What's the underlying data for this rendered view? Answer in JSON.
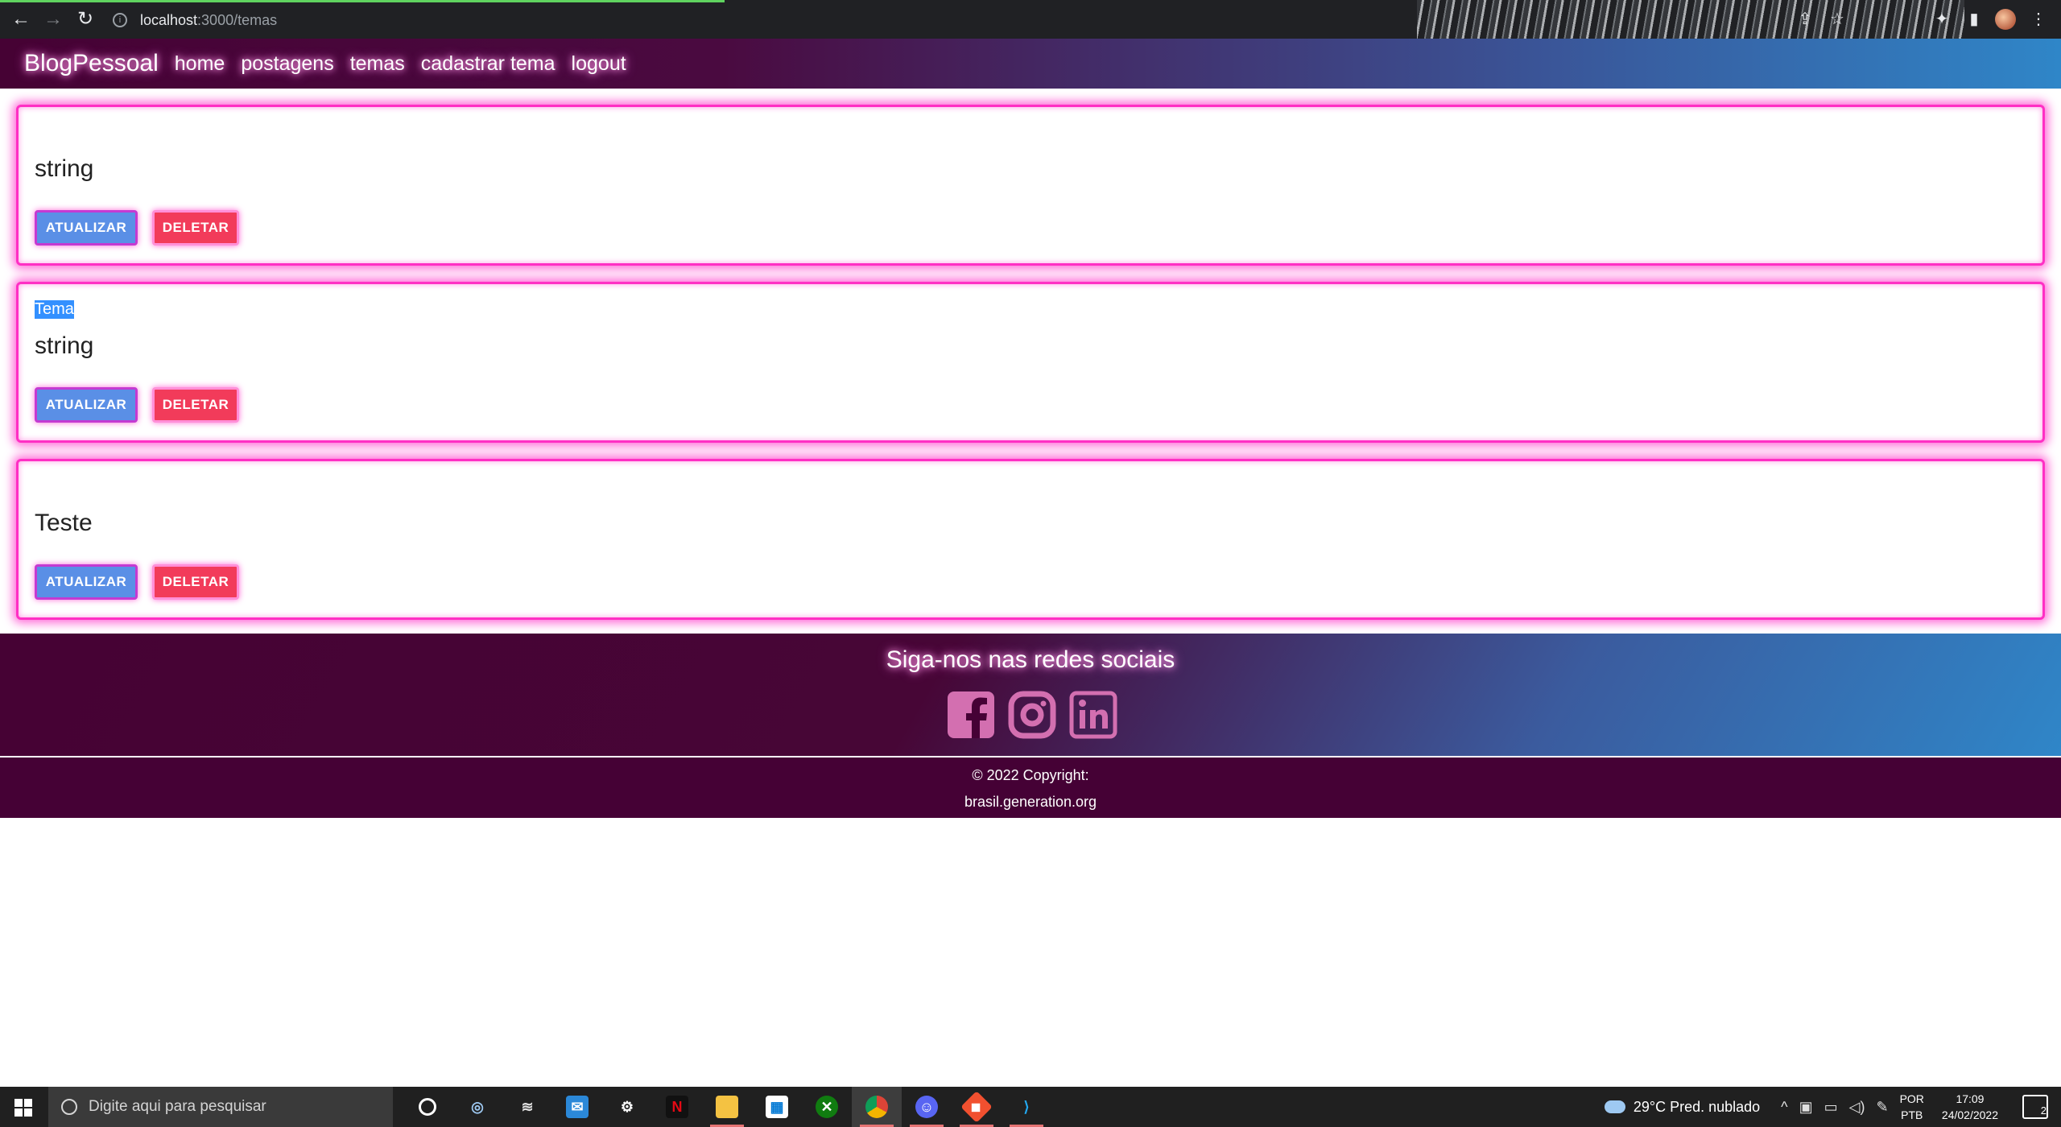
{
  "browser": {
    "url_host": "localhost",
    "url_path": ":3000/temas"
  },
  "navbar": {
    "brand": "BlogPessoal",
    "links": [
      "home",
      "postagens",
      "temas",
      "cadastrar tema",
      "logout"
    ]
  },
  "cards": [
    {
      "label": "",
      "title": "string",
      "update_label": "ATUALIZAR",
      "delete_label": "DELETAR"
    },
    {
      "label": "Tema",
      "title": "string",
      "update_label": "ATUALIZAR",
      "delete_label": "DELETAR"
    },
    {
      "label": "",
      "title": "Teste",
      "update_label": "ATUALIZAR",
      "delete_label": "DELETAR"
    }
  ],
  "footer": {
    "heading": "Siga-nos nas redes sociais",
    "social": [
      "facebook-icon",
      "instagram-icon",
      "linkedin-icon"
    ],
    "copyright": "© 2022 Copyright:",
    "site": "brasil.generation.org"
  },
  "taskbar": {
    "search_placeholder": "Digite aqui para pesquisar",
    "weather": "29°C  Pred. nublado",
    "lang_top": "POR",
    "lang_bottom": "PTB",
    "time": "17:09",
    "date": "24/02/2022",
    "notifications": "2"
  },
  "colors": {
    "neon_pink": "#ff2fc4",
    "brand_purple": "#460234",
    "brand_blue": "#2f86c8",
    "update_button": "#5a8fe6",
    "delete_button": "#f23b5a",
    "social_icon": "#d36fb0"
  }
}
